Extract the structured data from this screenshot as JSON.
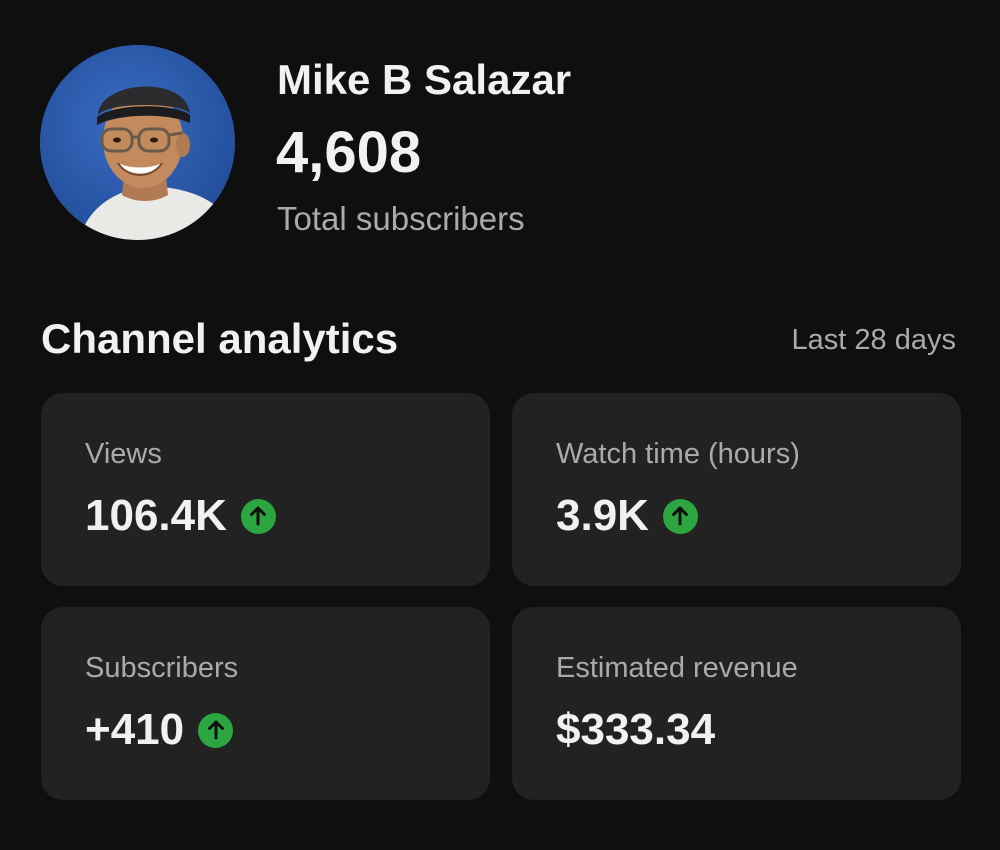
{
  "channel": {
    "name": "Mike B Salazar",
    "subscriber_count": "4,608",
    "subscriber_label": "Total subscribers",
    "avatar_icon": "profile-photo"
  },
  "analytics": {
    "title": "Channel analytics",
    "period": "Last 28 days",
    "trend_color": "#2ba640",
    "cards": [
      {
        "label": "Views",
        "value": "106.4K",
        "trend": "up"
      },
      {
        "label": "Watch time (hours)",
        "value": "3.9K",
        "trend": "up"
      },
      {
        "label": "Subscribers",
        "value": "+410",
        "trend": "up"
      },
      {
        "label": "Estimated revenue",
        "value": "$333.34",
        "trend": "none"
      }
    ]
  }
}
